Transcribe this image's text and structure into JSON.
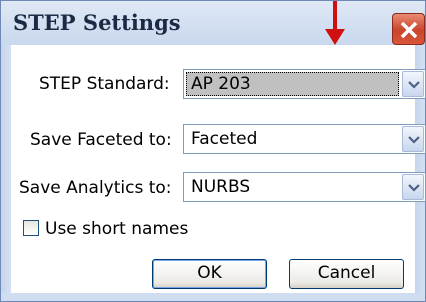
{
  "window": {
    "title": "STEP Settings",
    "close_icon": "close-icon"
  },
  "fields": [
    {
      "label": "STEP Standard:",
      "value": "AP 203"
    },
    {
      "label": "Save Faceted to:",
      "value": "Faceted"
    },
    {
      "label": "Save Analytics to:",
      "value": "NURBS"
    }
  ],
  "checkbox": {
    "label": "Use short names",
    "checked": false
  },
  "buttons": {
    "ok": "OK",
    "cancel": "Cancel"
  },
  "colors": {
    "arrow": "#d01010",
    "close": "#c9452b",
    "focus_fill": "#c0c0c0"
  }
}
